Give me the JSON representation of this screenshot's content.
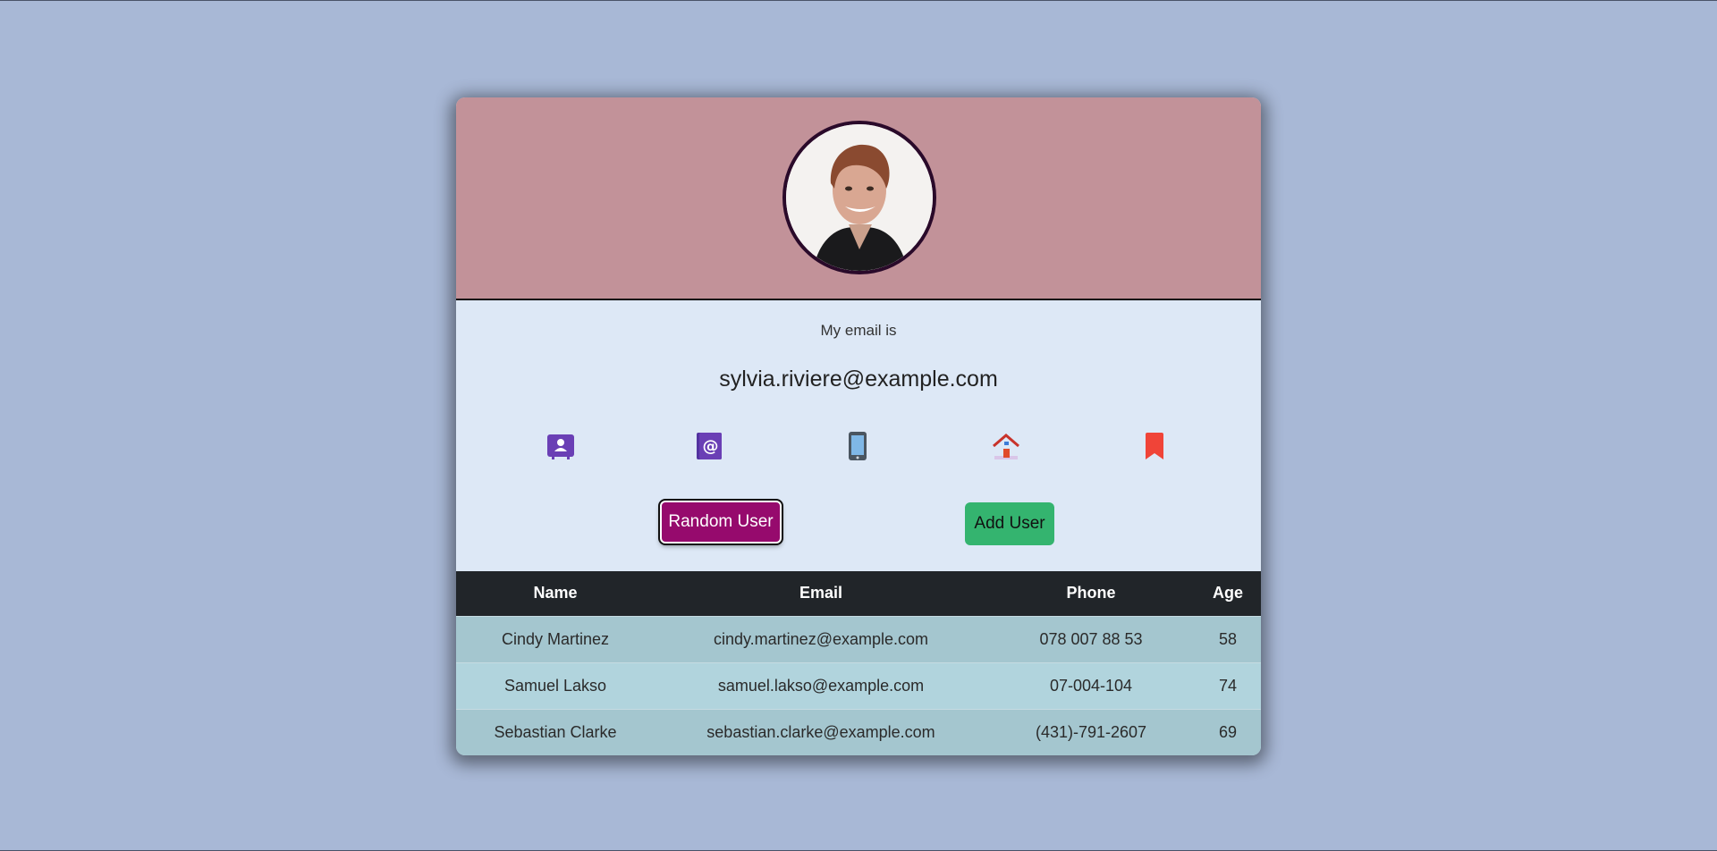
{
  "profile": {
    "label": "My email is",
    "value": "sylvia.riviere@example.com",
    "avatar_alt": "user-avatar"
  },
  "icons": [
    {
      "name": "user-card-icon",
      "color": "#6a3fb5"
    },
    {
      "name": "email-icon",
      "color": "#6a3fb5"
    },
    {
      "name": "phone-icon",
      "color": "#4a5560"
    },
    {
      "name": "home-icon",
      "color": "#d6402b"
    },
    {
      "name": "bookmark-icon",
      "color": "#f04438"
    }
  ],
  "buttons": {
    "random_user": "Random User",
    "add_user": "Add User"
  },
  "table": {
    "headers": [
      "Name",
      "Email",
      "Phone",
      "Age"
    ],
    "rows": [
      [
        "Cindy Martinez",
        "cindy.martinez@example.com",
        "078 007 88 53",
        "58"
      ],
      [
        "Samuel Lakso",
        "samuel.lakso@example.com",
        "07-004-104",
        "74"
      ],
      [
        "Sebastian Clarke",
        "sebastian.clarke@example.com",
        "(431)-791-2607",
        "69"
      ]
    ]
  },
  "colors": {
    "page_bg": "#a8b8d6",
    "header_bg": "#c29299",
    "card_bg": "#dde8f6",
    "random_btn": "#960a6d",
    "add_btn": "#34b46f",
    "table_head": "#212529"
  }
}
